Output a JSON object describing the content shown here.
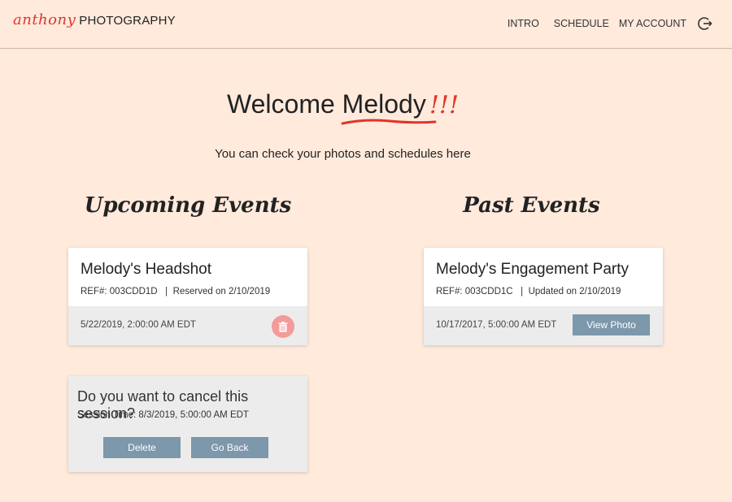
{
  "header": {
    "logo_script": "anthony",
    "logo_text": "PHOTOGRAPHY",
    "nav": {
      "intro": "INTRO",
      "schedule": "SCHEDULE",
      "account": "MY ACCOUNT"
    },
    "logout_icon": "logout-icon"
  },
  "welcome": {
    "prefix": "Welcome",
    "name": "Melody",
    "exclaim": "!!!",
    "subtitle": "You can check your photos and schedules here"
  },
  "sections": {
    "upcoming_title": "Upcoming Events",
    "past_title": "Past Events"
  },
  "upcoming_card": {
    "title": "Melody's Headshot",
    "ref": "REF#: 003CDD1D",
    "status": "Reserved on 2/10/2019",
    "date": "5/22/2019, 2:00:00 AM EDT",
    "delete_icon": "trash-icon"
  },
  "past_card": {
    "title": "Melody's Engagement Party",
    "ref": "REF#: 003CDD1C",
    "status": "Updated on 2/10/2019",
    "date": "10/17/2017, 5:00:00 AM EDT",
    "view_label": "View Photo"
  },
  "cancel_dialog": {
    "question": "Do you want to cancel this session?",
    "session_time": "Session Time: 8/3/2019, 5:00:00 AM EDT",
    "delete_label": "Delete",
    "goback_label": "Go Back"
  },
  "colors": {
    "background": "#ffeadc",
    "accent_red": "#e0352b",
    "button": "#7d97ab",
    "trash": "#f39a9a"
  }
}
